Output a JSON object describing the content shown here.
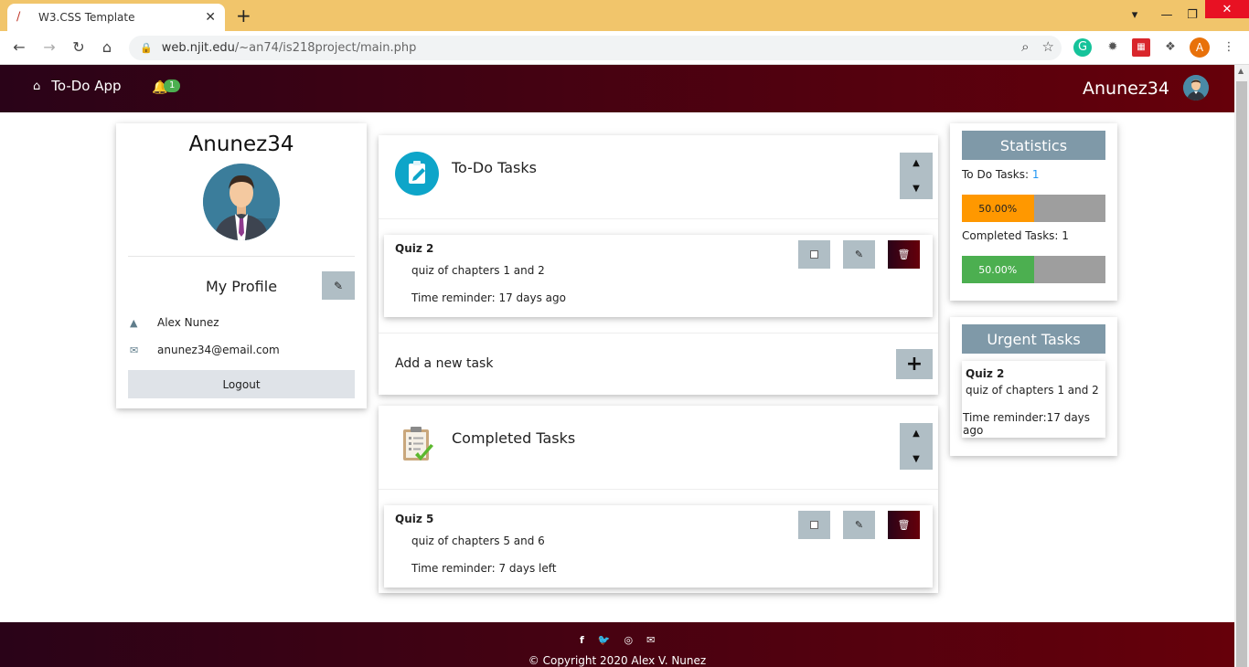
{
  "browser": {
    "tab_title": "W3.CSS Template",
    "url_host": "web.njit.edu",
    "url_path": "/~an74/is218project/main.php",
    "profile_initial": "A"
  },
  "nav": {
    "home_label": "To-Do App",
    "notifications_count": "1",
    "username": "Anunez34"
  },
  "profile": {
    "username": "Anunez34",
    "section_title": "My Profile",
    "full_name": "Alex Nunez",
    "email": "anunez34@email.com",
    "logout_label": "Logout"
  },
  "todo": {
    "title": "To-Do Tasks",
    "tasks": [
      {
        "name": "Quiz 2",
        "description": "quiz of chapters 1 and 2",
        "reminder": "Time reminder: 17 days ago"
      }
    ],
    "add_label": "Add a new task"
  },
  "completed": {
    "title": "Completed Tasks",
    "tasks": [
      {
        "name": "Quiz 5",
        "description": "quiz of chapters 5 and 6",
        "reminder": "Time reminder: 7 days left"
      }
    ]
  },
  "statistics": {
    "title": "Statistics",
    "todo_label": "To Do Tasks: ",
    "todo_count": "1",
    "todo_percent_label": "50.00%",
    "todo_fraction": 0.5,
    "completed_label": "Completed Tasks: 1",
    "completed_percent_label": "50.00%",
    "completed_fraction": 0.5
  },
  "urgent": {
    "title": "Urgent Tasks",
    "tasks": [
      {
        "name": "Quiz 2",
        "description": "quiz of chapters 1 and 2",
        "reminder": "Time reminder:17 days ago"
      }
    ]
  },
  "footer": {
    "copyright": "© Copyright 2020 Alex V. Nunez"
  },
  "colors": {
    "brand_dark": "#2a0318",
    "brand_red": "#66000a",
    "button_gray": "#b0bec5",
    "progress_orange": "#ff9800",
    "progress_green": "#4caf50",
    "progress_track": "#9e9e9e",
    "card_header": "#7f99a8"
  }
}
